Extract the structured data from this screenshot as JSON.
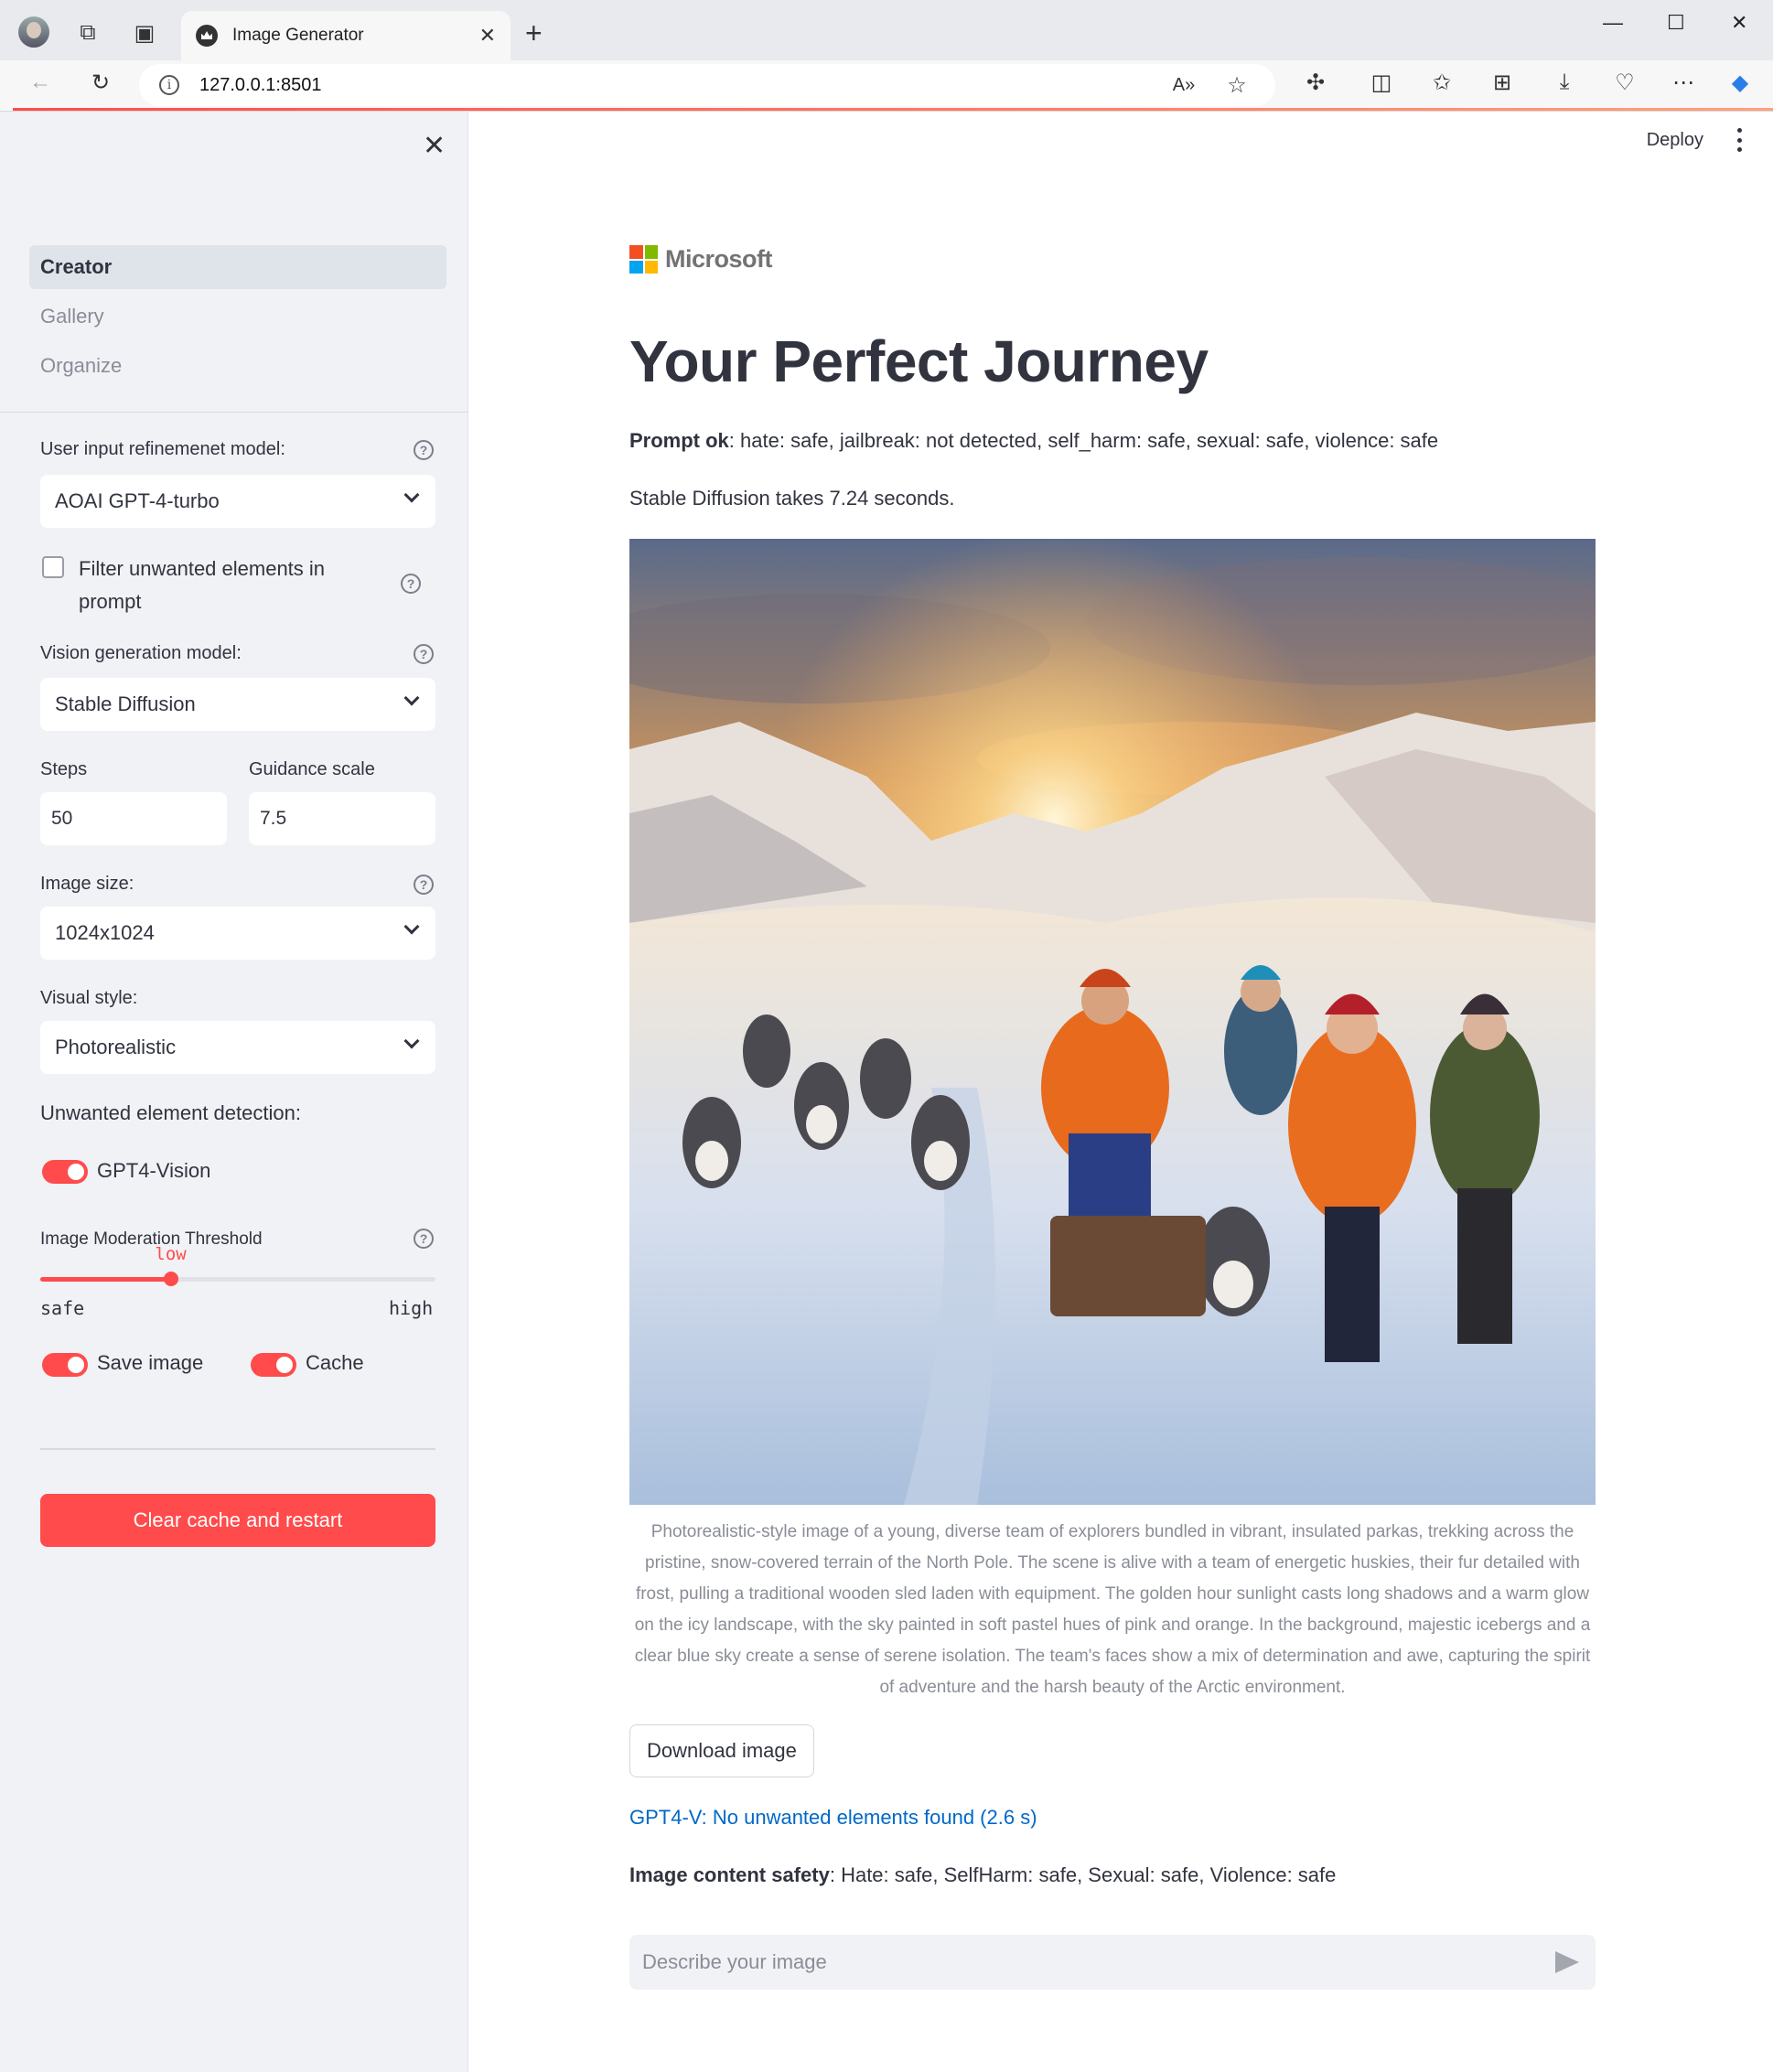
{
  "browser": {
    "tab_title": "Image Generator",
    "url": "127.0.0.1:8501"
  },
  "sidebar": {
    "nav": [
      {
        "label": "Creator",
        "active": true
      },
      {
        "label": "Gallery",
        "active": false
      },
      {
        "label": "Organize",
        "active": false
      }
    ],
    "refinement_label": "User input refinemenet model:",
    "refinement_value": "AOAI GPT-4-turbo",
    "filter_label": "Filter unwanted elements in prompt",
    "filter_checked": false,
    "vision_label": "Vision generation model:",
    "vision_value": "Stable Diffusion",
    "steps_label": "Steps",
    "steps_value": "50",
    "guidance_label": "Guidance scale",
    "guidance_value": "7.5",
    "size_label": "Image size:",
    "size_value": "1024x1024",
    "style_label": "Visual style:",
    "style_value": "Photorealistic",
    "detection_label": "Unwanted element detection:",
    "gpt4v_label": "GPT4-Vision",
    "gpt4v_on": true,
    "threshold_label": "Image Moderation Threshold",
    "threshold_value": "low",
    "threshold_fraction": 0.33,
    "threshold_min": "safe",
    "threshold_max": "high",
    "save_label": "Save image",
    "save_on": true,
    "cache_label": "Cache",
    "cache_on": true,
    "clear_button": "Clear cache and restart"
  },
  "main": {
    "deploy": "Deploy",
    "logo_text": "Microsoft",
    "title": "Your Perfect Journey",
    "prompt_ok_label": "Prompt ok",
    "prompt_ok_text": ": hate: safe, jailbreak: not detected, self_harm: safe, sexual: safe, violence: safe",
    "timing": "Stable Diffusion takes 7.24 seconds.",
    "caption": "Photorealistic-style image of a young, diverse team of explorers bundled in vibrant, insulated parkas, trekking across the pristine, snow-covered terrain of the North Pole. The scene is alive with a team of energetic huskies, their fur detailed with frost, pulling a traditional wooden sled laden with equipment. The golden hour sunlight casts long shadows and a warm glow on the icy landscape, with the sky painted in soft pastel hues of pink and orange. In the background, majestic icebergs and a clear blue sky create a sense of serene isolation. The team's faces show a mix of determination and awe, capturing the spirit of adventure and the harsh beauty of the Arctic environment.",
    "download_button": "Download image",
    "gpt4v_result": "GPT4-V: No unwanted elements found (2.6 s)",
    "safety_label": "Image content safety",
    "safety_text": ": Hate: safe, SelfHarm: safe, Sexual: safe, Violence: safe",
    "chat_placeholder": "Describe your image"
  },
  "colors": {
    "accent": "#ff4b4b",
    "link": "#0068c9",
    "sidebar_bg": "#f0f2f6"
  }
}
